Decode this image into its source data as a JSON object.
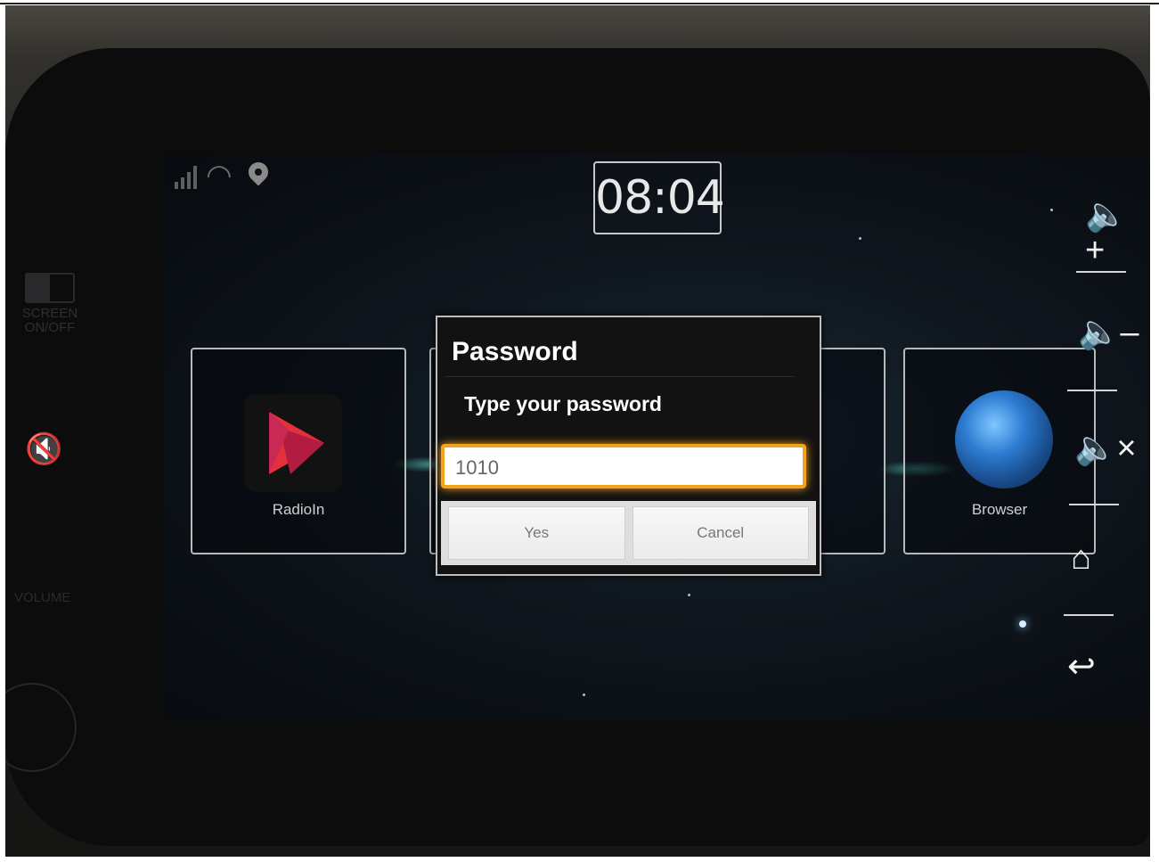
{
  "status_bar": {
    "signal_icon": "signal-bars-icon",
    "wifi_icon": "wifi-icon",
    "location_icon": "location-pin-icon"
  },
  "clock": {
    "time": "08:04"
  },
  "apps": [
    {
      "label": "RadioIn",
      "icon": "radioin-play-logo-icon"
    },
    {
      "label": "",
      "icon": ""
    },
    {
      "label": "",
      "icon": ""
    },
    {
      "label": "Browser",
      "icon": "globe-icon"
    }
  ],
  "side_controls": [
    {
      "name": "volume-up",
      "icon": "volume-up-icon"
    },
    {
      "name": "volume-down",
      "icon": "volume-down-icon"
    },
    {
      "name": "mute",
      "icon": "mute-icon"
    },
    {
      "name": "home",
      "icon": "home-icon"
    },
    {
      "name": "back",
      "icon": "back-icon"
    }
  ],
  "bezel": {
    "screen_toggle_label": "SCREEN ON/OFF",
    "volume_label": "VOLUME"
  },
  "dialog": {
    "title": "Password",
    "message": "Type your password",
    "input_value": "1010",
    "yes_label": "Yes",
    "cancel_label": "Cancel"
  },
  "colors": {
    "input_focus_border": "#f3a21b",
    "dialog_background": "#121212",
    "screen_background": "#0f161d"
  }
}
